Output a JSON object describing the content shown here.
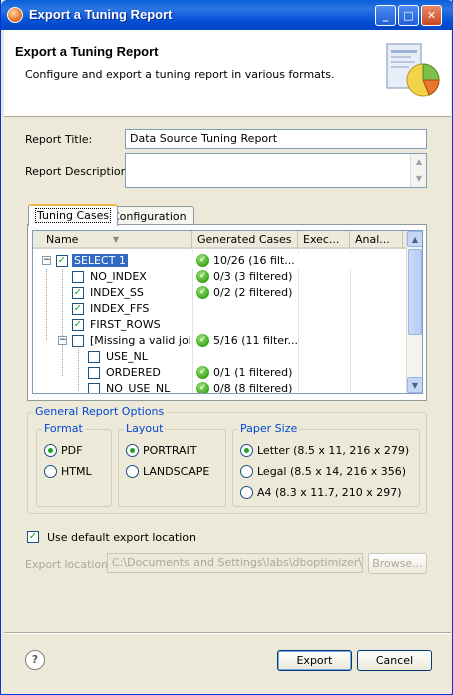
{
  "window": {
    "title": "Export a Tuning Report",
    "icon": "app-icon"
  },
  "header": {
    "title": "Export a Tuning Report",
    "description": "Configure and export a tuning report in various formats."
  },
  "form": {
    "report_title_label": "Report Title:",
    "report_title_value": "Data Source Tuning Report",
    "report_description_label": "Report Description:",
    "report_description_value": ""
  },
  "tabs": [
    {
      "label": "Tuning Cases",
      "active": true
    },
    {
      "label": "Configuration",
      "active": false
    }
  ],
  "table": {
    "columns": [
      "Name",
      "Generated Cases",
      "Exec...",
      "Anal..."
    ],
    "rows": [
      {
        "name": "SELECT 1",
        "checked": true,
        "expanded": true,
        "status": "ok",
        "generated": "10/26 (16 filt..."
      },
      {
        "name": "NO_INDEX",
        "checked": false,
        "status": "ok",
        "generated": "0/3 (3 filtered)"
      },
      {
        "name": "INDEX_SS",
        "checked": true,
        "status": "ok",
        "generated": "0/2 (2 filtered)"
      },
      {
        "name": "INDEX_FFS",
        "checked": true,
        "status": "",
        "generated": ""
      },
      {
        "name": "FIRST_ROWS",
        "checked": true,
        "status": "",
        "generated": ""
      },
      {
        "name": "[Missing a valid join c",
        "checked": false,
        "expanded": true,
        "status": "ok",
        "generated": "5/16 (11 filter..."
      },
      {
        "name": "USE_NL",
        "checked": false,
        "status": "",
        "generated": ""
      },
      {
        "name": "ORDERED",
        "checked": false,
        "status": "ok",
        "generated": "0/1 (1 filtered)"
      },
      {
        "name": "NO_USE_NL",
        "checked": false,
        "status": "ok",
        "generated": "0/8 (8 filtered)"
      }
    ]
  },
  "options": {
    "group_label": "General Report Options",
    "format": {
      "label": "Format",
      "options": [
        "PDF",
        "HTML"
      ],
      "selected": "PDF"
    },
    "layout": {
      "label": "Layout",
      "options": [
        "PORTRAIT",
        "LANDSCAPE"
      ],
      "selected": "PORTRAIT"
    },
    "paper": {
      "label": "Paper Size",
      "options": [
        "Letter (8.5 x 11, 216 x 279)",
        "Legal (8.5 x 14, 216 x 356)",
        "A4 (8.3 x 11.7, 210 x 297)"
      ],
      "selected": "Letter (8.5 x 11, 216 x 279)"
    }
  },
  "export": {
    "default_location_label": "Use default export location",
    "default_location_checked": true,
    "location_label": "Export location:",
    "location_value": "C:\\Documents and Settings\\labs\\dboptimizer\\works",
    "browse_label": "Browse..."
  },
  "buttons": {
    "export": "Export",
    "cancel": "Cancel",
    "help": "?"
  }
}
